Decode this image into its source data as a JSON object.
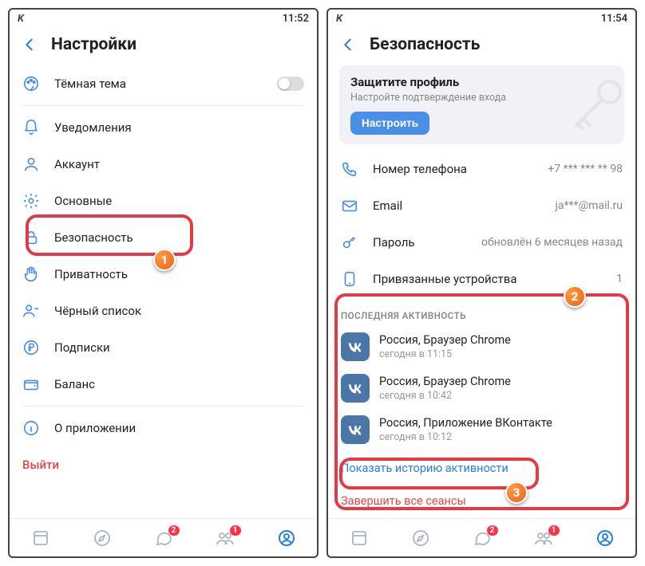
{
  "left": {
    "status_time": "11:52",
    "status_app": "K",
    "header_title": "Настройки",
    "items": {
      "theme": "Тёмная тема",
      "notifications": "Уведомления",
      "account": "Аккаунт",
      "general": "Основные",
      "security": "Безопасность",
      "privacy": "Приватность",
      "blacklist": "Чёрный список",
      "subscriptions": "Подписки",
      "balance": "Баланс",
      "about": "О приложении"
    },
    "logout": "Выйти",
    "callout1": "1",
    "tab_badges": {
      "messages": "2",
      "friends": "1"
    }
  },
  "right": {
    "status_time": "11:54",
    "status_app": "K",
    "header_title": "Безопасность",
    "promo": {
      "title": "Защитите профиль",
      "sub": "Настройте подтверждение входа",
      "button": "Настроить"
    },
    "rows": {
      "phone_label": "Номер телефона",
      "phone_value": "+7 *** *** ** 98",
      "email_label": "Email",
      "email_value": "ja***@mail.ru",
      "password_label": "Пароль",
      "password_value": "обновлён 6 месяцев назад",
      "devices_label": "Привязанные устройства",
      "devices_value": "1"
    },
    "activity_header": "ПОСЛЕДНЯЯ АКТИВНОСТЬ",
    "sessions": [
      {
        "title": "Россия, Браузер Chrome",
        "sub": "сегодня в 11:15"
      },
      {
        "title": "Россия, Браузер Chrome",
        "sub": "сегодня в 10:42"
      },
      {
        "title": "Россия, Приложение ВКонтакте",
        "sub": "сегодня в 10:12"
      }
    ],
    "show_history": "Показать историю активности",
    "end_sessions": "Завершить все сеансы",
    "callout2": "2",
    "callout3": "3",
    "tab_badges": {
      "messages": "2",
      "friends": "1"
    }
  }
}
